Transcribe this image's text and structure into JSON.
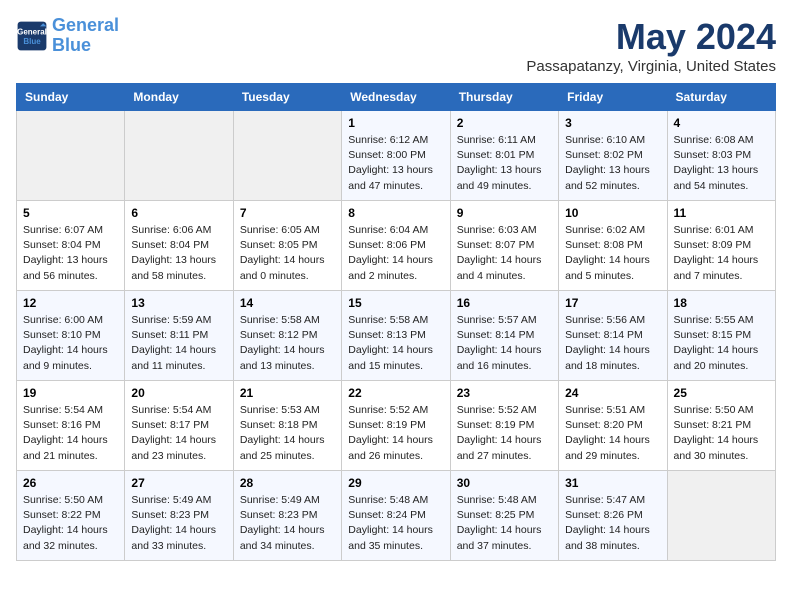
{
  "logo": {
    "line1": "General",
    "line2": "Blue"
  },
  "title": "May 2024",
  "location": "Passapatanzy, Virginia, United States",
  "headers": [
    "Sunday",
    "Monday",
    "Tuesday",
    "Wednesday",
    "Thursday",
    "Friday",
    "Saturday"
  ],
  "weeks": [
    [
      {
        "day": "",
        "info": ""
      },
      {
        "day": "",
        "info": ""
      },
      {
        "day": "",
        "info": ""
      },
      {
        "day": "1",
        "info": "Sunrise: 6:12 AM\nSunset: 8:00 PM\nDaylight: 13 hours\nand 47 minutes."
      },
      {
        "day": "2",
        "info": "Sunrise: 6:11 AM\nSunset: 8:01 PM\nDaylight: 13 hours\nand 49 minutes."
      },
      {
        "day": "3",
        "info": "Sunrise: 6:10 AM\nSunset: 8:02 PM\nDaylight: 13 hours\nand 52 minutes."
      },
      {
        "day": "4",
        "info": "Sunrise: 6:08 AM\nSunset: 8:03 PM\nDaylight: 13 hours\nand 54 minutes."
      }
    ],
    [
      {
        "day": "5",
        "info": "Sunrise: 6:07 AM\nSunset: 8:04 PM\nDaylight: 13 hours\nand 56 minutes."
      },
      {
        "day": "6",
        "info": "Sunrise: 6:06 AM\nSunset: 8:04 PM\nDaylight: 13 hours\nand 58 minutes."
      },
      {
        "day": "7",
        "info": "Sunrise: 6:05 AM\nSunset: 8:05 PM\nDaylight: 14 hours\nand 0 minutes."
      },
      {
        "day": "8",
        "info": "Sunrise: 6:04 AM\nSunset: 8:06 PM\nDaylight: 14 hours\nand 2 minutes."
      },
      {
        "day": "9",
        "info": "Sunrise: 6:03 AM\nSunset: 8:07 PM\nDaylight: 14 hours\nand 4 minutes."
      },
      {
        "day": "10",
        "info": "Sunrise: 6:02 AM\nSunset: 8:08 PM\nDaylight: 14 hours\nand 5 minutes."
      },
      {
        "day": "11",
        "info": "Sunrise: 6:01 AM\nSunset: 8:09 PM\nDaylight: 14 hours\nand 7 minutes."
      }
    ],
    [
      {
        "day": "12",
        "info": "Sunrise: 6:00 AM\nSunset: 8:10 PM\nDaylight: 14 hours\nand 9 minutes."
      },
      {
        "day": "13",
        "info": "Sunrise: 5:59 AM\nSunset: 8:11 PM\nDaylight: 14 hours\nand 11 minutes."
      },
      {
        "day": "14",
        "info": "Sunrise: 5:58 AM\nSunset: 8:12 PM\nDaylight: 14 hours\nand 13 minutes."
      },
      {
        "day": "15",
        "info": "Sunrise: 5:58 AM\nSunset: 8:13 PM\nDaylight: 14 hours\nand 15 minutes."
      },
      {
        "day": "16",
        "info": "Sunrise: 5:57 AM\nSunset: 8:14 PM\nDaylight: 14 hours\nand 16 minutes."
      },
      {
        "day": "17",
        "info": "Sunrise: 5:56 AM\nSunset: 8:14 PM\nDaylight: 14 hours\nand 18 minutes."
      },
      {
        "day": "18",
        "info": "Sunrise: 5:55 AM\nSunset: 8:15 PM\nDaylight: 14 hours\nand 20 minutes."
      }
    ],
    [
      {
        "day": "19",
        "info": "Sunrise: 5:54 AM\nSunset: 8:16 PM\nDaylight: 14 hours\nand 21 minutes."
      },
      {
        "day": "20",
        "info": "Sunrise: 5:54 AM\nSunset: 8:17 PM\nDaylight: 14 hours\nand 23 minutes."
      },
      {
        "day": "21",
        "info": "Sunrise: 5:53 AM\nSunset: 8:18 PM\nDaylight: 14 hours\nand 25 minutes."
      },
      {
        "day": "22",
        "info": "Sunrise: 5:52 AM\nSunset: 8:19 PM\nDaylight: 14 hours\nand 26 minutes."
      },
      {
        "day": "23",
        "info": "Sunrise: 5:52 AM\nSunset: 8:19 PM\nDaylight: 14 hours\nand 27 minutes."
      },
      {
        "day": "24",
        "info": "Sunrise: 5:51 AM\nSunset: 8:20 PM\nDaylight: 14 hours\nand 29 minutes."
      },
      {
        "day": "25",
        "info": "Sunrise: 5:50 AM\nSunset: 8:21 PM\nDaylight: 14 hours\nand 30 minutes."
      }
    ],
    [
      {
        "day": "26",
        "info": "Sunrise: 5:50 AM\nSunset: 8:22 PM\nDaylight: 14 hours\nand 32 minutes."
      },
      {
        "day": "27",
        "info": "Sunrise: 5:49 AM\nSunset: 8:23 PM\nDaylight: 14 hours\nand 33 minutes."
      },
      {
        "day": "28",
        "info": "Sunrise: 5:49 AM\nSunset: 8:23 PM\nDaylight: 14 hours\nand 34 minutes."
      },
      {
        "day": "29",
        "info": "Sunrise: 5:48 AM\nSunset: 8:24 PM\nDaylight: 14 hours\nand 35 minutes."
      },
      {
        "day": "30",
        "info": "Sunrise: 5:48 AM\nSunset: 8:25 PM\nDaylight: 14 hours\nand 37 minutes."
      },
      {
        "day": "31",
        "info": "Sunrise: 5:47 AM\nSunset: 8:26 PM\nDaylight: 14 hours\nand 38 minutes."
      },
      {
        "day": "",
        "info": ""
      }
    ]
  ]
}
